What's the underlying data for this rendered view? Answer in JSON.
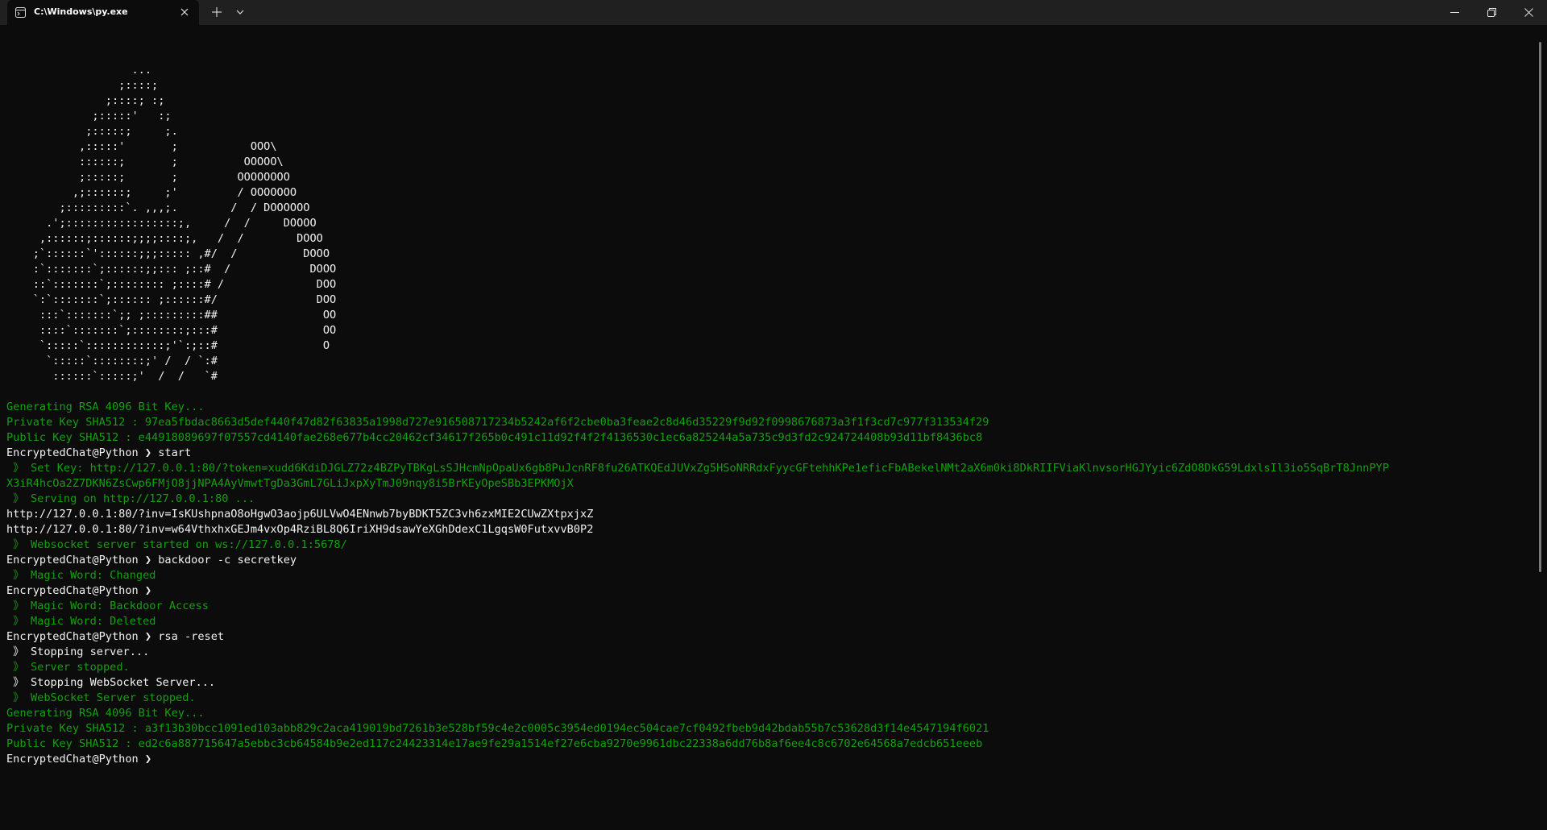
{
  "window": {
    "tab_title": "C:\\Windows\\py.exe"
  },
  "icons": {
    "tab": "terminal-icon",
    "tab_close": "close-icon",
    "new_tab": "plus-icon",
    "dropdown": "chevron-down-icon",
    "minimize": "minimize-icon",
    "restore": "restore-icon",
    "close": "close-icon"
  },
  "colors": {
    "background": "#0c0c0c",
    "titlebar": "#202020",
    "green": "#13a10e",
    "white": "#f2f2f2"
  },
  "console": {
    "art": [
      "                   ...",
      "                 ;::::;",
      "               ;::::; :;",
      "             ;:::::'   :;",
      "            ;:::::;     ;.",
      "           ,:::::'       ;           OOO\\",
      "           ::::::;       ;          OOOOO\\",
      "           ;:::::;       ;         OOOOOOOO",
      "          ,;::::::;     ;'         / OOOOOOO",
      "        ;:::::::::`. ,,,;.        /  / DOOOOOO",
      "      .';:::::::::::::::::;,     /  /     DOOOO",
      "     ,::::::;::::::;;;;::::;,   /  /        DOOO",
      "    ;`::::::`'::::::;;;::::: ,#/  /          DOOO",
      "    :`:::::::`;::::::;;::: ;::#  /            DOOO",
      "    ::`:::::::`;:::::::: ;::::# /              DOO",
      "    `:`:::::::`;:::::: ;::::::#/               DOO",
      "     :::`:::::::`;; ;:::::::::##                OO",
      "     ::::`:::::::`;::::::::;:::#                OO",
      "     `:::::`::::::::::::;'`:;::#                O",
      "      `:::::`::::::::;' /  / `:#",
      "       ::::::`:::::;'  /  /   `#"
    ],
    "lines": [
      {
        "text": "",
        "style": "white"
      },
      {
        "text": "Generating RSA 4096 Bit Key...",
        "style": "green"
      },
      {
        "text": "Private Key SHA512 : 97ea5fbdac8663d5def440f47d82f63835a1998d727e916508717234b5242af6f2cbe0ba3feae2c8d46d35229f9d92f0998676873a3f1f3cd7c977f313534f29",
        "style": "green"
      },
      {
        "text": "Public Key SHA512 : e44918089697f07557cd4140fae268e677b4cc20462cf34617f265b0c491c11d92f4f2f4136530c1ec6a825244a5a735c9d3fd2c924724408b93d11bf8436bc8",
        "style": "green"
      },
      {
        "text": "EncryptedChat@Python ❯ start",
        "style": "white"
      },
      {
        "text": " 》 Set Key: http://127.0.0.1:80/?token=xudd6KdiDJGLZ72z4BZPyTBKgLsSJHcmNpOpaUx6gb8PuJcnRF8fu26ATKQEdJUVxZg5HSoNRRdxFyycGFtehhKPe1eficFbABekelNMt2aX6m0ki8DkRIIFViaKlnvsorHGJYyic6ZdO8DkG59LdxlsIl3io5SqBrT8JnnPYP",
        "style": "green"
      },
      {
        "text": "X3iR4hcOa2Z7DKN6ZsCwp6FMjO8jjNPA4AyVmwtTgDa3GmL7GLiJxpXyTmJ09nqy8i5BrKEyOpeSBb3EPKMOjX",
        "style": "green"
      },
      {
        "text": " 》 Serving on http://127.0.0.1:80 ...",
        "style": "green"
      },
      {
        "text": "http://127.0.0.1:80/?inv=IsKUshpnaO8oHgwO3aojp6ULVwO4ENnwb7byBDKT5ZC3vh6zxMIE2CUwZXtpxjxZ",
        "style": "white"
      },
      {
        "text": "http://127.0.0.1:80/?inv=w64VthxhxGEJm4vxOp4RziBL8Q6IriXH9dsawYeXGhDdexC1LgqsW0FutxvvB0P2",
        "style": "white"
      },
      {
        "text": " 》 Websocket server started on ws://127.0.0.1:5678/",
        "style": "green"
      },
      {
        "text": "EncryptedChat@Python ❯ backdoor -c secretkey",
        "style": "white"
      },
      {
        "text": " 》 Magic Word: Changed",
        "style": "green"
      },
      {
        "text": "EncryptedChat@Python ❯",
        "style": "white"
      },
      {
        "text": " 》 Magic Word: Backdoor Access",
        "style": "green"
      },
      {
        "text": " 》 Magic Word: Deleted",
        "style": "green"
      },
      {
        "text": "EncryptedChat@Python ❯ rsa -reset",
        "style": "white"
      },
      {
        "text": " 》 Stopping server...",
        "style": "white"
      },
      {
        "text": " 》 Server stopped.",
        "style": "green"
      },
      {
        "text": " 》 Stopping WebSocket Server...",
        "style": "white"
      },
      {
        "text": " 》 WebSocket Server stopped.",
        "style": "green"
      },
      {
        "text": "Generating RSA 4096 Bit Key...",
        "style": "green"
      },
      {
        "text": "Private Key SHA512 : a3f13b30bcc1091ed103abb829c2aca419019bd7261b3e528bf59c4e2c0005c3954ed0194ec504cae7cf0492fbeb9d42bdab55b7c53628d3f14e4547194f6021",
        "style": "green"
      },
      {
        "text": "Public Key SHA512 : ed2c6a887715647a5ebbc3cb64584b9e2ed117c24423314e17ae9fe29a1514ef27e6cba9270e9961dbc22338a6dd76b8af6ee4c8c6702e64568a7edcb651eeeb",
        "style": "green"
      },
      {
        "text": "EncryptedChat@Python ❯",
        "style": "white"
      }
    ]
  }
}
